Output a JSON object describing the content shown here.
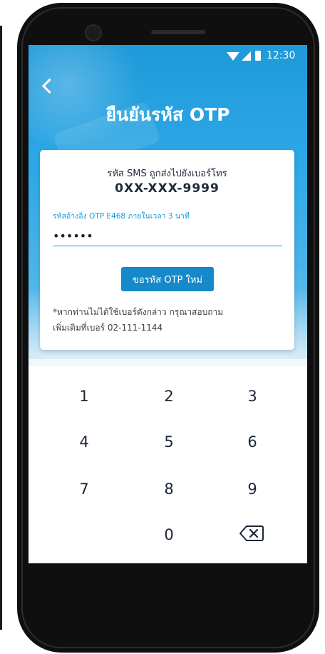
{
  "status_bar": {
    "time": "12:30"
  },
  "header": {
    "title": "ยืนยันรหัส OTP"
  },
  "card": {
    "sent_text": "รหัส SMS ถูกส่งไปยังเบอร์โทร",
    "phone_number": "0XX-XXX-9999",
    "ref_text": "รหัสอ้างอิง OTP E468 ภายในเวลา 3 นาที",
    "otp_value": "••••••",
    "resend_label": "ขอรหัส OTP ใหม่",
    "note_line1": "*หากท่านไม่ได้ใช้เบอร์ดังกล่าว กรุณาสอบถาม",
    "note_line2": "เพิ่มเติมที่เบอร์ 02-111-1144"
  },
  "keypad": {
    "k1": "1",
    "k2": "2",
    "k3": "3",
    "k4": "4",
    "k5": "5",
    "k6": "6",
    "k7": "7",
    "k8": "8",
    "k9": "9",
    "k0": "0",
    "backspace_icon": "backspace-icon"
  },
  "colors": {
    "primary": "#1f9ad9",
    "button": "#1589c9",
    "text_dark": "#1c2638"
  }
}
